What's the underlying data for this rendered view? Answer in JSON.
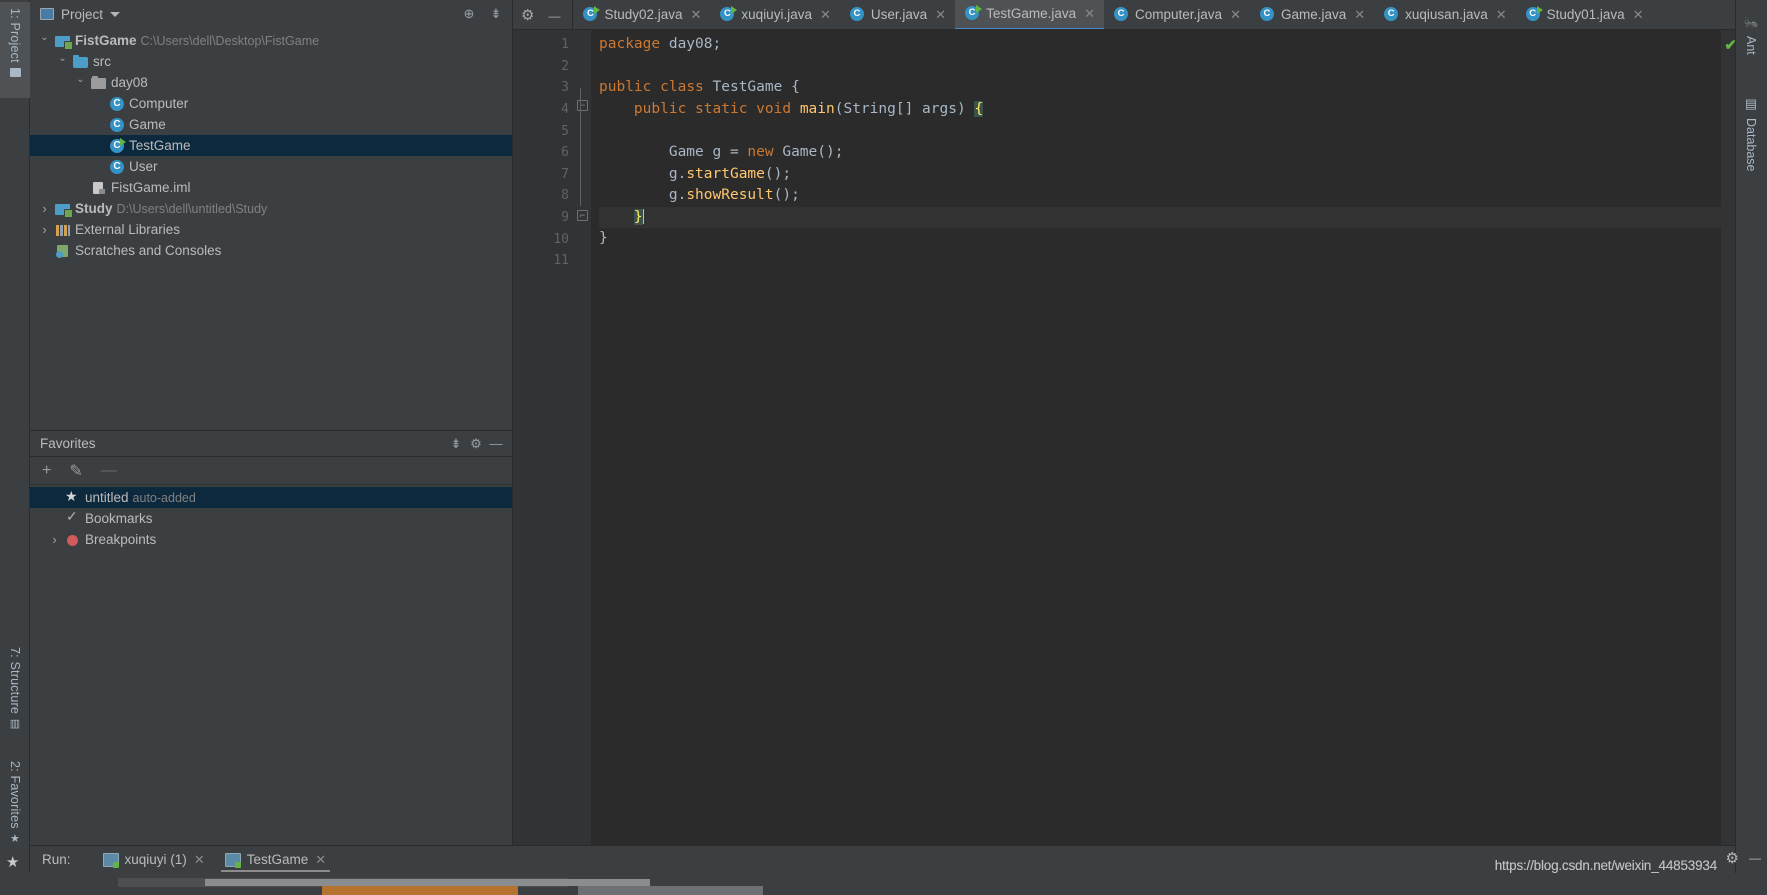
{
  "left_strip": {
    "tabs": [
      {
        "label": "1: Project",
        "icon": "folder-icon",
        "selected": true
      },
      {
        "label": "7: Structure",
        "icon": "structure-icon",
        "selected": false
      },
      {
        "label": "2: Favorites",
        "icon": "star-icon",
        "selected": false
      }
    ]
  },
  "right_strip": {
    "tabs": [
      {
        "label": "Ant",
        "icon": "ant-icon"
      },
      {
        "label": "Database",
        "icon": "database-icon"
      }
    ]
  },
  "project_panel": {
    "title": "Project",
    "toolbar": [
      {
        "name": "locate-icon",
        "glyph": "⊕"
      },
      {
        "name": "collapse-all-icon",
        "glyph": "≡"
      }
    ],
    "tree": [
      {
        "indent": 0,
        "arrow": "open",
        "icon": "module-icon",
        "name": "FistGame",
        "bold": true,
        "path": "C:\\Users\\dell\\Desktop\\FistGame",
        "selected": false
      },
      {
        "indent": 1,
        "arrow": "open",
        "icon": "folder-icon",
        "name": "src",
        "bold": false,
        "path": "",
        "selected": false
      },
      {
        "indent": 2,
        "arrow": "open",
        "icon": "package-icon",
        "name": "day08",
        "bold": false,
        "path": "",
        "selected": false
      },
      {
        "indent": 3,
        "arrow": "none",
        "icon": "class-icon",
        "name": "Computer",
        "bold": false,
        "path": "",
        "selected": false
      },
      {
        "indent": 3,
        "arrow": "none",
        "icon": "class-icon",
        "name": "Game",
        "bold": false,
        "path": "",
        "selected": false
      },
      {
        "indent": 3,
        "arrow": "none",
        "icon": "class-runnable-icon",
        "name": "TestGame",
        "bold": false,
        "path": "",
        "selected": true
      },
      {
        "indent": 3,
        "arrow": "none",
        "icon": "class-icon",
        "name": "User",
        "bold": false,
        "path": "",
        "selected": false
      },
      {
        "indent": 2,
        "arrow": "none",
        "icon": "iml-file-icon",
        "name": "FistGame.iml",
        "bold": false,
        "path": "",
        "selected": false
      },
      {
        "indent": 0,
        "arrow": "closed",
        "icon": "module-icon",
        "name": "Study",
        "bold": true,
        "path": "D:\\Users\\dell\\untitled\\Study",
        "selected": false
      },
      {
        "indent": 0,
        "arrow": "closed",
        "icon": "library-icon",
        "name": "External Libraries",
        "bold": false,
        "path": "",
        "selected": false
      },
      {
        "indent": 0,
        "arrow": "none",
        "icon": "scratch-icon",
        "name": "Scratches and Consoles",
        "bold": false,
        "path": "",
        "selected": false
      }
    ]
  },
  "favorites_panel": {
    "title": "Favorites",
    "toolbar": [
      {
        "name": "add-icon",
        "glyph": "+",
        "enabled": true
      },
      {
        "name": "edit-icon",
        "glyph": "✎",
        "enabled": true
      },
      {
        "name": "remove-icon",
        "glyph": "—",
        "enabled": false
      }
    ],
    "items": [
      {
        "indent": 0,
        "arrow": "none",
        "icon": "star-icon",
        "name": "untitled",
        "note": "auto-added",
        "selected": true
      },
      {
        "indent": 0,
        "arrow": "none",
        "icon": "bookmark-check-icon",
        "name": "Bookmarks",
        "note": "",
        "selected": false
      },
      {
        "indent": 0,
        "arrow": "closed",
        "icon": "breakpoint-icon",
        "name": "Breakpoints",
        "note": "",
        "selected": false
      }
    ]
  },
  "editor": {
    "toolbar": [
      {
        "name": "settings-gear-icon"
      },
      {
        "name": "hide-icon"
      }
    ],
    "tabs": [
      {
        "label": "Study02.java",
        "icon": "class-runnable-icon",
        "active": false
      },
      {
        "label": "xuqiuyi.java",
        "icon": "class-runnable-icon",
        "active": false
      },
      {
        "label": "User.java",
        "icon": "class-icon",
        "active": false
      },
      {
        "label": "TestGame.java",
        "icon": "class-runnable-icon",
        "active": true
      },
      {
        "label": "Computer.java",
        "icon": "class-icon",
        "active": false
      },
      {
        "label": "Game.java",
        "icon": "class-icon",
        "active": false
      },
      {
        "label": "xuqiusan.java",
        "icon": "class-icon",
        "active": false
      },
      {
        "label": "Study01.java",
        "icon": "class-runnable-icon",
        "active": false
      }
    ],
    "line_numbers": [
      "1",
      "2",
      "3",
      "4",
      "5",
      "6",
      "7",
      "8",
      "9",
      "10",
      "11"
    ],
    "current_line": 9,
    "run_markers": [
      3,
      4
    ],
    "code_lines": [
      "package day08;",
      "",
      "public class TestGame {",
      "    public static void main(String[] args) {",
      "",
      "        Game g = new Game();",
      "        g.startGame();",
      "        g.showResult();",
      "    }",
      "}",
      ""
    ],
    "inspection_status": "ok",
    "inspection_glyph": "✔"
  },
  "run_bar": {
    "label": "Run:",
    "tabs": [
      {
        "label": "xuqiuyi (1)",
        "active": false
      },
      {
        "label": "TestGame",
        "active": true
      }
    ]
  },
  "status_bar": {
    "watermark": "https://blog.csdn.net/weixin_44853934",
    "gear_icon": "⚙",
    "minimize_icon": "—"
  },
  "colors": {
    "panel_bg": "#3c3f41",
    "editor_bg": "#2b2b2b",
    "gutter_bg": "#313335",
    "selection_blue": "#0d293e",
    "accent_blue": "#4a88c7",
    "keyword_orange": "#cc7832",
    "method_yellow": "#ffc66d",
    "text": "#a9b7c6",
    "green": "#62b543"
  }
}
